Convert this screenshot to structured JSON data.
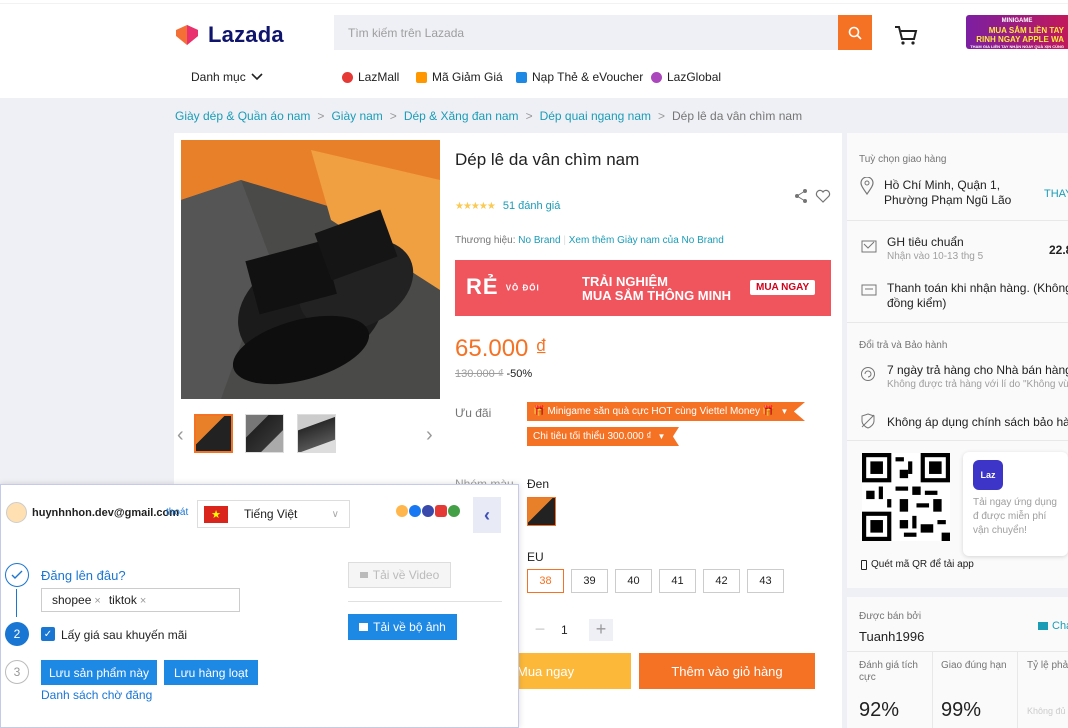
{
  "header": {
    "logo_text": "Lazada",
    "search_placeholder": "Tìm kiếm trên Lazada",
    "promo_banner": [
      "MINIGAME",
      "MUA SẮM LIỀN TAY",
      "RINH NGAY APPLE WA",
      "THAM GIA LIỀN TAY NHẬN NGAY QUÀ XỊN CÙNG"
    ],
    "nav": {
      "category_label": "Danh mục",
      "items": [
        "LazMall",
        "Mã Giảm Giá",
        "Nạp Thẻ & eVoucher",
        "LazGlobal"
      ]
    }
  },
  "breadcrumb": {
    "items": [
      "Giày dép & Quần áo nam",
      "Giày nam",
      "Dép & Xăng đan nam",
      "Dép quai ngang nam"
    ],
    "current": "Dép lê da vân chìm nam"
  },
  "product": {
    "title": "Dép lê da vân chìm nam",
    "review_count": "51 đánh giá",
    "brand_prefix": "Thương hiệu:",
    "brand": "No Brand",
    "brand_more": "Xem thêm Giày nam của No Brand",
    "banner": {
      "logo": "RẺ",
      "logo_small": "VÔ ĐỐI",
      "line1": "TRẢI NGHIỆM",
      "line2": "MUA SẮM THÔNG MINH",
      "button": "MUA NGAY"
    },
    "price": "65.000 ₫",
    "old_price": "130.000 ₫",
    "discount": "-50%",
    "offers_label": "Ưu đãi",
    "offers": [
      "Minigame săn quà cực HOT cùng Viettel Money",
      "Chi tiêu tối thiểu 300.000 ₫"
    ],
    "color_label": "Nhóm màu",
    "color_value": "Đen",
    "size_label": "EU",
    "sizes": [
      "38",
      "39",
      "40",
      "41",
      "42",
      "43"
    ],
    "selected_size": "38",
    "quantity": "1",
    "buy_now": "Mua ngay",
    "add_to_cart": "Thêm vào giỏ hàng"
  },
  "delivery": {
    "section_title": "Tuỳ chọn giao hàng",
    "address_line1": "Hồ Chí Minh, Quận 1,",
    "address_line2": "Phường Phạm Ngũ Lão",
    "change_label": "THAY",
    "shipping_name": "GH tiêu chuẩn",
    "shipping_eta": "Nhận vào 10-13 thg 5",
    "shipping_price": "22.8",
    "cod_line1": "Thanh toán khi nhận hàng. (Không đ",
    "cod_line2": "đồng kiểm)"
  },
  "returns": {
    "section_title": "Đổi trả và Bảo hành",
    "return_policy": "7 ngày trả hàng cho Nhà bán hàng",
    "return_note": "Không được trả hàng với lí do \"Không vừa",
    "warranty": "Không áp dụng chính sách bảo hành"
  },
  "app_promo": {
    "icon_text": "Laz",
    "text": "Tải ngay ứng dụng đ được miễn phí vận chuyển!",
    "qr_label": "Quét mã QR để tải app"
  },
  "seller": {
    "sold_by_label": "Được bán bởi",
    "name": "Tuanh1996",
    "chat_label": "Cha",
    "metrics": [
      {
        "label": "Đánh giá tích cực",
        "value": "92%"
      },
      {
        "label": "Giao đúng hạn",
        "value": "99%"
      },
      {
        "label": "Tỷ lệ phả",
        "value": "Không đủ"
      }
    ]
  },
  "extension": {
    "email": "huynhnhon.dev@gmail.com",
    "logout": "thoát",
    "language": "Tiếng Việt",
    "step1_question": "Đăng lên đâu?",
    "step1_tags": [
      "shopee",
      "tiktok"
    ],
    "step2_label": "Lấy giá sau khuyến mãi",
    "download_video": "Tải về Video",
    "download_images": "Tải về bộ ảnh",
    "save_product": "Lưu sản phẩm này",
    "save_bulk": "Lưu hàng loạt",
    "queue_link": "Danh sách chờ đăng",
    "steps": [
      "1",
      "2",
      "3"
    ]
  }
}
